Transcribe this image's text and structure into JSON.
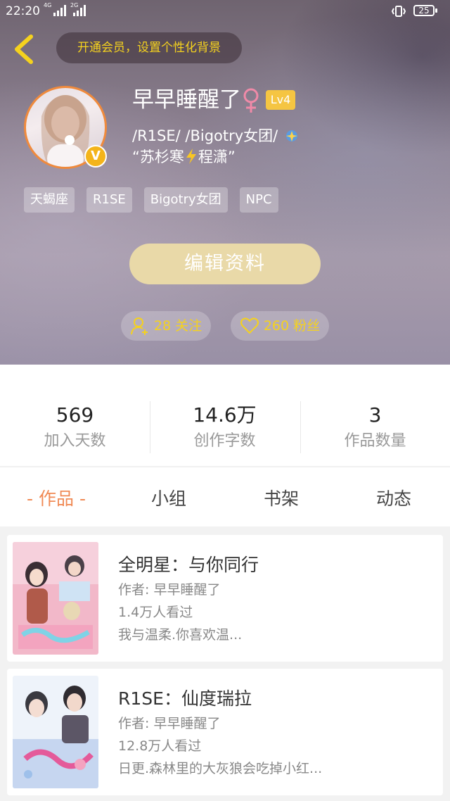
{
  "status_bar": {
    "time": "22:20",
    "network1": "4G",
    "network2": "2G",
    "battery": "25"
  },
  "header": {
    "vip_banner": "开通会员，设置个性化背景",
    "username": "早早睡醒了",
    "level": "Lv4",
    "verified_badge": "V",
    "bio_line1": "/R1SE/ /Bigotry女团/",
    "bio_line2_a": "“苏杉寒",
    "bio_line2_b": "程潇”",
    "tags": [
      "天蝎座",
      "R1SE",
      "Bigotry女团",
      "NPC"
    ],
    "edit_button": "编辑资料",
    "following": "28 关注",
    "fans": "260 粉丝",
    "accent_color": "#f5d21e"
  },
  "stats": [
    {
      "value": "569",
      "label": "加入天数"
    },
    {
      "value": "14.6万",
      "label": "创作字数"
    },
    {
      "value": "3",
      "label": "作品数量"
    }
  ],
  "tabs": [
    {
      "label": "- 作品 -",
      "active": true
    },
    {
      "label": "小组",
      "active": false
    },
    {
      "label": "书架",
      "active": false
    },
    {
      "label": "动态",
      "active": false
    }
  ],
  "works": [
    {
      "title": "全明星：与你同行",
      "author": "作者: 早早睡醒了",
      "views": "1.4万人看过",
      "summary": "我与温柔.你喜欢温..."
    },
    {
      "title": "R1SE：仙度瑞拉",
      "author": "作者: 早早睡醒了",
      "views": "12.8万人看过",
      "summary": "日更.森林里的大灰狼会吃掉小红..."
    }
  ]
}
